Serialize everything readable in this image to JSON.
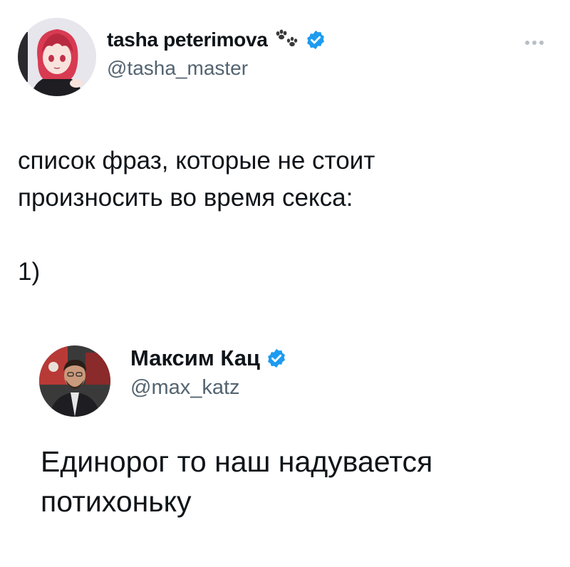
{
  "author": {
    "display_name": "tasha peterimova",
    "handle": "@tasha_master",
    "paw_icon": "paw-prints-icon",
    "verified_icon": "verified-badge-icon",
    "verified_color": "#1d9bf0"
  },
  "tweet": {
    "text": "список фраз, которые не стоит\nпроизносить во время секса:\n\n1)"
  },
  "quoted": {
    "display_name": "Максим Кац",
    "handle": "@max_katz",
    "text": "Единорог то наш надувается\nпотихоньку",
    "verified_icon": "verified-badge-icon"
  },
  "menu": {
    "more_icon": "more-options-icon"
  }
}
